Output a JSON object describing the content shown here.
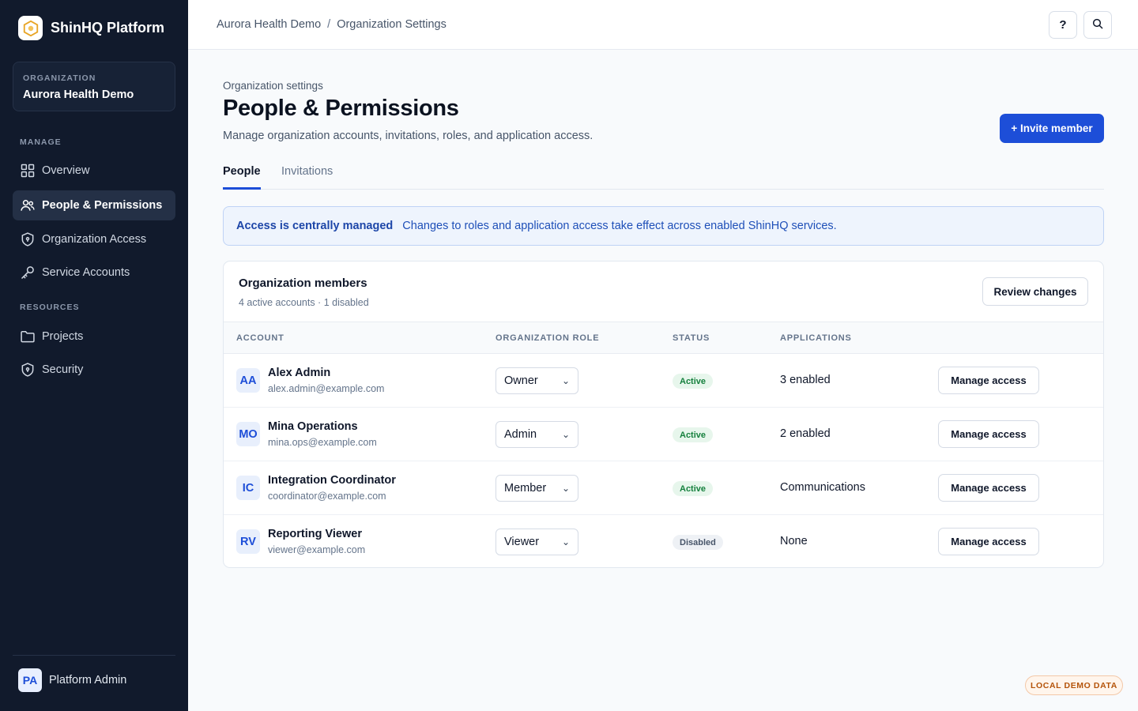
{
  "brand": {
    "name": "ShinHQ Platform",
    "logo_icon": "hexagon-logo-icon"
  },
  "organization": {
    "label": "ORGANIZATION",
    "name": "Aurora Health Demo"
  },
  "sidebar": {
    "manage_label": "MANAGE",
    "manage_items": [
      {
        "label": "Overview",
        "icon": "grid-icon",
        "active": false
      },
      {
        "label": "People & Permissions",
        "icon": "users-icon",
        "active": true
      },
      {
        "label": "Organization Access",
        "icon": "shield-icon",
        "active": false
      },
      {
        "label": "Service Accounts",
        "icon": "key-icon",
        "active": false
      }
    ],
    "resources_label": "RESOURCES",
    "resources_items": [
      {
        "label": "Projects",
        "icon": "folder-icon"
      },
      {
        "label": "Security",
        "icon": "shield-icon"
      }
    ],
    "user": {
      "initials": "PA",
      "name": "Platform Admin"
    }
  },
  "topbar": {
    "breadcrumb": [
      "Aurora Health Demo",
      "Organization Settings"
    ],
    "breadcrumb_separator": "/",
    "help_label": "?",
    "search_icon": "search-icon"
  },
  "page": {
    "eyebrow": "Organization settings",
    "title": "People & Permissions",
    "subtitle": "Manage organization accounts, invitations, roles, and application access.",
    "invite_label": "+ Invite member"
  },
  "tabs": [
    {
      "label": "People",
      "active": true
    },
    {
      "label": "Invitations",
      "active": false
    }
  ],
  "banner": {
    "title": "Access is centrally managed",
    "text": "Changes to roles and application access take effect across enabled ShinHQ services."
  },
  "members": {
    "title": "Organization members",
    "summary": "4 active accounts · 1 disabled",
    "review_label": "Review changes",
    "columns": [
      "ACCOUNT",
      "ORGANIZATION ROLE",
      "STATUS",
      "APPLICATIONS"
    ],
    "rows": [
      {
        "initials": "AA",
        "name": "Alex Admin",
        "email": "alex.admin@example.com",
        "role": "Owner",
        "status": "Active",
        "status_kind": "active",
        "applications": "3 enabled",
        "action": "Manage access"
      },
      {
        "initials": "MO",
        "name": "Mina Operations",
        "email": "mina.ops@example.com",
        "role": "Admin",
        "status": "Active",
        "status_kind": "active",
        "applications": "2 enabled",
        "action": "Manage access"
      },
      {
        "initials": "IC",
        "name": "Integration Coordinator",
        "email": "coordinator@example.com",
        "role": "Member",
        "status": "Active",
        "status_kind": "active",
        "applications": "Communications",
        "action": "Manage access"
      },
      {
        "initials": "RV",
        "name": "Reporting Viewer",
        "email": "viewer@example.com",
        "role": "Viewer",
        "status": "Disabled",
        "status_kind": "disabled",
        "applications": "None",
        "action": "Manage access"
      }
    ]
  },
  "demo_tag": "LOCAL DEMO DATA",
  "colors": {
    "sidebar_bg": "#111a2c",
    "accent": "#1d4ed8",
    "active_green": "#15803d"
  }
}
